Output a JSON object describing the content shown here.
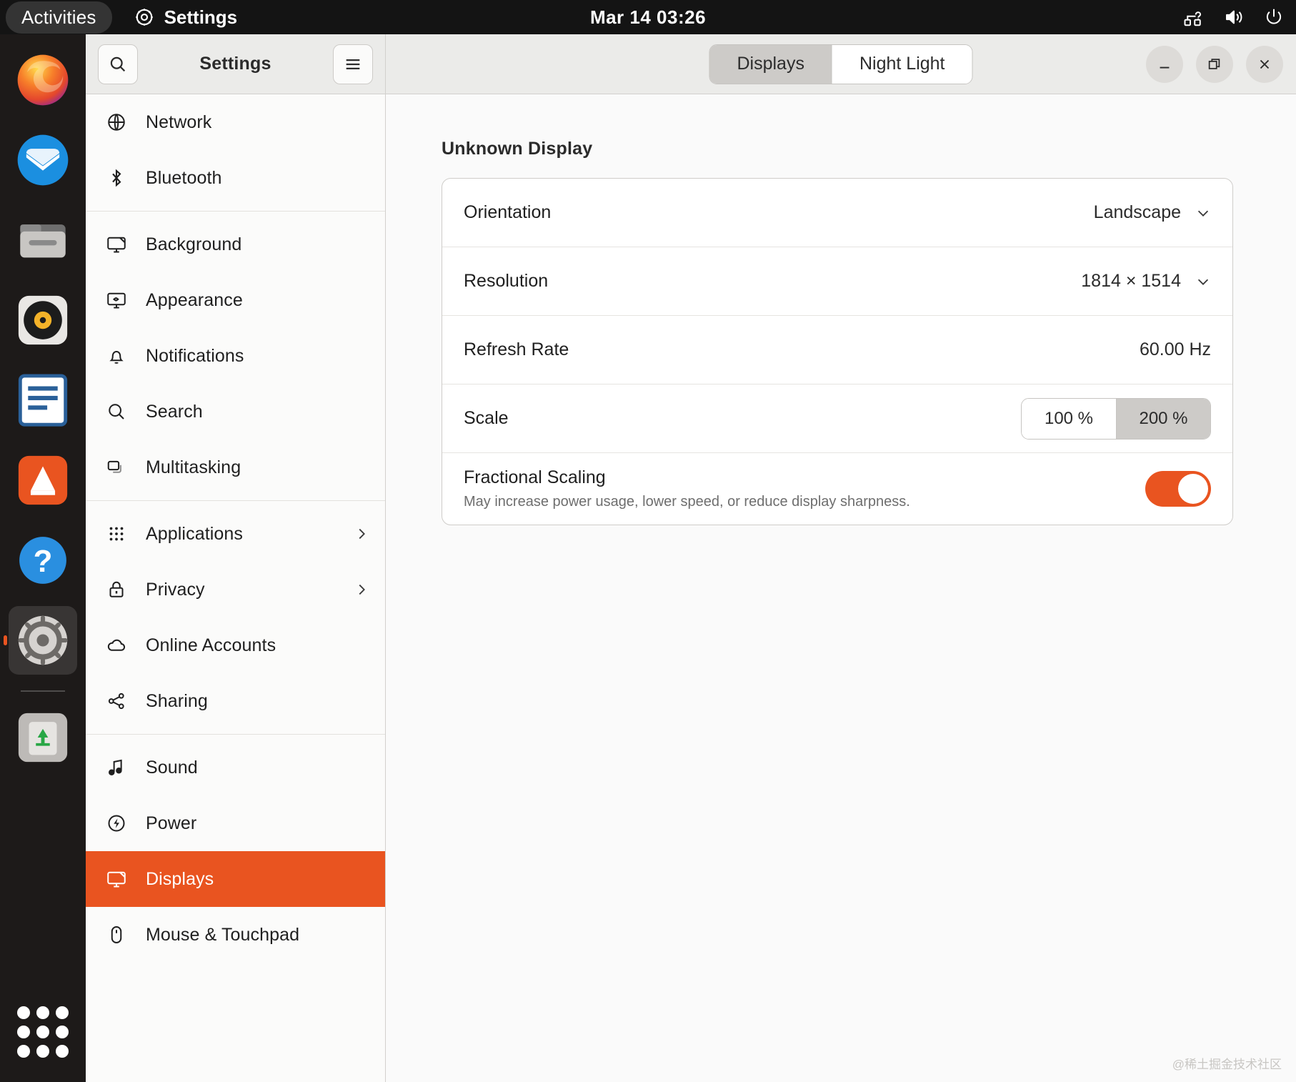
{
  "topbar": {
    "activities_label": "Activities",
    "app_name": "Settings",
    "app_icon": "gear-icon",
    "clock": "Mar 14  03:26",
    "status_icons": [
      "network-question-icon",
      "volume-icon",
      "power-icon"
    ]
  },
  "dock": {
    "items": [
      {
        "name": "firefox",
        "label": "Firefox",
        "running": false
      },
      {
        "name": "thunderbird",
        "label": "Thunderbird",
        "running": false
      },
      {
        "name": "files",
        "label": "Files",
        "running": false
      },
      {
        "name": "rhythmbox",
        "label": "Rhythmbox",
        "running": false
      },
      {
        "name": "libreoffice-writer",
        "label": "LibreOffice Writer",
        "running": false
      },
      {
        "name": "ubuntu-software",
        "label": "Ubuntu Software",
        "running": false
      },
      {
        "name": "help",
        "label": "Help",
        "running": false
      },
      {
        "name": "settings",
        "label": "Settings",
        "running": true
      },
      {
        "name": "trash",
        "label": "Trash",
        "running": false
      }
    ],
    "show_apps_label": "Show Applications"
  },
  "window": {
    "sidebar_title": "Settings",
    "search_icon": "search-icon",
    "menu_icon": "hamburger-menu-icon",
    "tabs": [
      {
        "label": "Displays",
        "active": true
      },
      {
        "label": "Night Light",
        "active": false
      }
    ],
    "controls": [
      {
        "name": "minimize-button",
        "icon": "minimize-icon"
      },
      {
        "name": "maximize-button",
        "icon": "restore-icon"
      },
      {
        "name": "close-button",
        "icon": "close-icon"
      }
    ]
  },
  "sidebar": {
    "groups": [
      {
        "items": [
          {
            "label": "Network",
            "icon": "globe-icon",
            "selected": false,
            "chevron": false
          },
          {
            "label": "Bluetooth",
            "icon": "bluetooth-icon",
            "selected": false,
            "chevron": false
          }
        ]
      },
      {
        "items": [
          {
            "label": "Background",
            "icon": "monitor-icon",
            "selected": false,
            "chevron": false
          },
          {
            "label": "Appearance",
            "icon": "appearance-icon",
            "selected": false,
            "chevron": false
          },
          {
            "label": "Notifications",
            "icon": "bell-icon",
            "selected": false,
            "chevron": false
          },
          {
            "label": "Search",
            "icon": "search-icon",
            "selected": false,
            "chevron": false
          },
          {
            "label": "Multitasking",
            "icon": "multitasking-icon",
            "selected": false,
            "chevron": false
          }
        ]
      },
      {
        "items": [
          {
            "label": "Applications",
            "icon": "grid-dots-icon",
            "selected": false,
            "chevron": true
          },
          {
            "label": "Privacy",
            "icon": "lock-icon",
            "selected": false,
            "chevron": true
          },
          {
            "label": "Online Accounts",
            "icon": "cloud-icon",
            "selected": false,
            "chevron": false
          },
          {
            "label": "Sharing",
            "icon": "share-icon",
            "selected": false,
            "chevron": false
          }
        ]
      },
      {
        "items": [
          {
            "label": "Sound",
            "icon": "music-note-icon",
            "selected": false,
            "chevron": false
          },
          {
            "label": "Power",
            "icon": "power-bolt-icon",
            "selected": false,
            "chevron": false
          },
          {
            "label": "Displays",
            "icon": "displays-icon",
            "selected": true,
            "chevron": false
          },
          {
            "label": "Mouse & Touchpad",
            "icon": "mouse-icon",
            "selected": false,
            "chevron": false
          }
        ]
      }
    ]
  },
  "content": {
    "display_name": "Unknown Display",
    "rows": {
      "orientation": {
        "label": "Orientation",
        "value": "Landscape",
        "chevron": "chevron-down-icon"
      },
      "resolution": {
        "label": "Resolution",
        "value": "1814 × 1514",
        "chevron": "chevron-down-icon"
      },
      "refresh_rate": {
        "label": "Refresh Rate",
        "value": "60.00 Hz"
      },
      "scale": {
        "label": "Scale",
        "options": [
          {
            "label": "100 %",
            "active": false
          },
          {
            "label": "200 %",
            "active": true
          }
        ]
      },
      "fractional_scaling": {
        "label": "Fractional Scaling",
        "description": "May increase power usage, lower speed, or reduce display sharpness.",
        "enabled": true
      }
    },
    "watermark": "@稀土掘金技术社区"
  },
  "colors": {
    "accent": "#e95420",
    "topbar_bg": "#141414",
    "header_bg": "#ebebe9",
    "content_bg": "#fafafa"
  }
}
